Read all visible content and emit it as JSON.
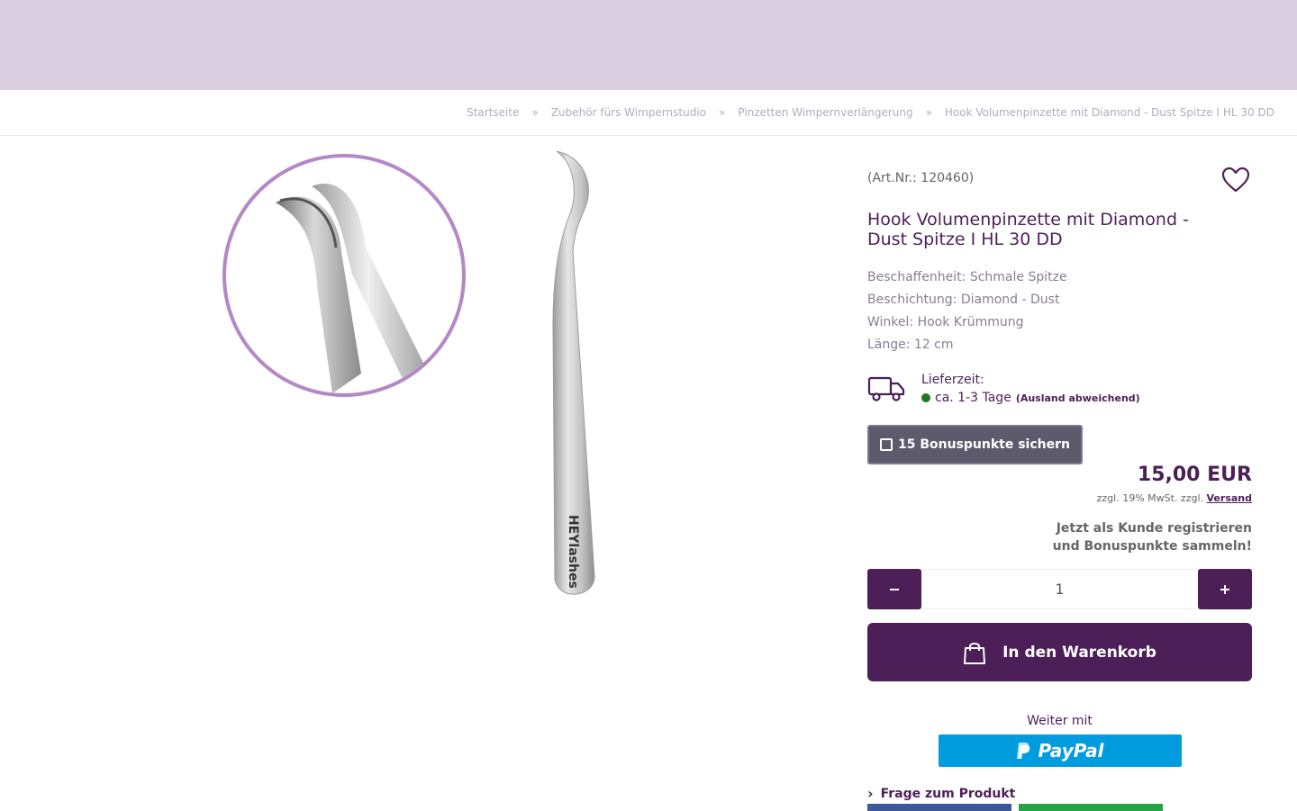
{
  "colors": {
    "banner": "#dacfe0",
    "brand": "#4c1f58",
    "bonus": "#5e5a6e",
    "paypal": "#009cde",
    "available": "#1f7a1f"
  },
  "breadcrumb": {
    "items": [
      "Startseite",
      "Zubehör fürs Wimpernstudio",
      "Pinzetten Wimpernverlängerung",
      "Hook Volumenpinzette mit Diamond - Dust Spitze I HL 30 DD"
    ],
    "separator": "»"
  },
  "gallery": {
    "brand_on_product": "HEYlashes"
  },
  "product": {
    "art_nr": "(Art.Nr.: 120460)",
    "wishlist_icon": "heart-icon",
    "title": "Hook Volumenpinzette mit Diamond - Dust Spitze I HL 30 DD",
    "properties": [
      "Beschaffenheit: Schmale Spitze",
      "Beschichtung: Diamond - Dust",
      "Winkel: Hook Krümmung",
      "Länge: 12 cm"
    ]
  },
  "delivery": {
    "icon": "truck-icon",
    "label": "Lieferzeit:",
    "value": "ca. 1-3 Tage",
    "note": "(Ausland abweichend)"
  },
  "bonus": {
    "icon": "gift-icon",
    "label": "15 Bonuspunkte sichern"
  },
  "price": {
    "amount": "15,00 EUR",
    "tax_text": "zzgl. 19% MwSt. zzgl.",
    "shipping_link": "Versand"
  },
  "register": {
    "line1": "Jetzt als Kunde registrieren",
    "line2": "und Bonuspunkte sammeln!"
  },
  "quantity": {
    "value": "1",
    "minus_icon": "minus-icon",
    "plus_icon": "plus-icon"
  },
  "cart": {
    "icon": "shopping-bag-icon",
    "label": "In den Warenkorb"
  },
  "checkout": {
    "weiter": "Weiter mit",
    "paypal": "PayPal"
  },
  "links": {
    "frage": "Frage zum Produkt"
  }
}
